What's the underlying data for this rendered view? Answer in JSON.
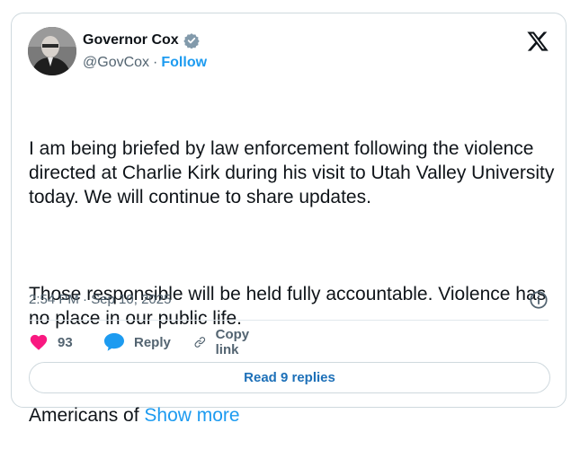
{
  "author": {
    "display_name": "Governor Cox",
    "handle": "@GovCox",
    "separator": "·",
    "follow_label": "Follow"
  },
  "tweet": {
    "paragraph_1": "I am being briefed by law enforcement following the violence directed at Charlie Kirk during his visit to Utah Valley University today. We will continue to share updates.",
    "paragraph_2": "Those responsible will be held fully accountable. Violence has no place in our public life.",
    "paragraph_3_start": "Americans of ",
    "show_more_label": "Show more",
    "timestamp": "2:54 PM · Sep 10, 2025"
  },
  "actions": {
    "like_count": "93",
    "reply_label": "Reply",
    "copy_link_label": "Copy link"
  },
  "footer": {
    "read_replies_label": "Read 9 replies"
  },
  "icons": {
    "verified": "verified-badge-icon",
    "x_logo": "x-logo-icon",
    "info": "info-icon",
    "heart": "heart-icon",
    "reply": "speech-bubble-icon",
    "link": "link-icon"
  },
  "colors": {
    "accent": "#1d9bf0",
    "heart": "#f91880",
    "reply_bubble": "#1d9bf0",
    "secondary_text": "#536471",
    "verified_badge": "#829aab"
  }
}
